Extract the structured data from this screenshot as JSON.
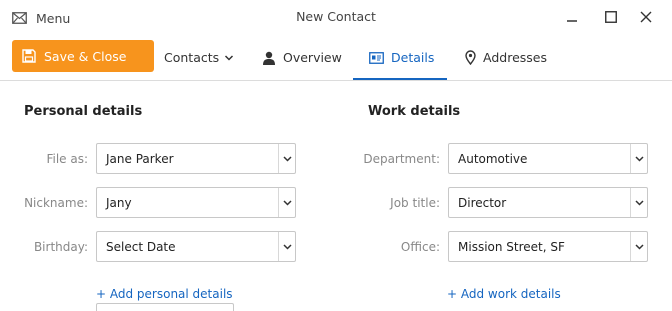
{
  "window": {
    "menu_label": "Menu",
    "title": "New Contact",
    "icons": [
      "menu-envelope-icon",
      "minimize-icon",
      "maximize-icon",
      "close-icon"
    ]
  },
  "toolbar": {
    "save_label": "Save & Close",
    "accent_color": "#f7941d",
    "active_color": "#1565c0",
    "tabs": [
      {
        "label": "Contacts",
        "icon": "chevron-down-icon"
      },
      {
        "label": "Overview",
        "icon": "person-icon"
      },
      {
        "label": "Details",
        "icon": "id-card-icon",
        "active": true
      },
      {
        "label": "Addresses",
        "icon": "map-pin-icon"
      }
    ]
  },
  "personal": {
    "title": "Personal details",
    "fields": [
      {
        "label": "File as:",
        "value": "Jane Parker"
      },
      {
        "label": "Nickname:",
        "value": "Jany"
      },
      {
        "label": "Birthday:",
        "value": "Select Date"
      }
    ],
    "add_link": "+ Add personal details"
  },
  "work": {
    "title": "Work details",
    "fields": [
      {
        "label": "Department:",
        "value": "Automotive"
      },
      {
        "label": "Job title:",
        "value": "Director"
      },
      {
        "label": "Office:",
        "value": "Mission Street, SF"
      }
    ],
    "add_link": "+ Add work details"
  }
}
